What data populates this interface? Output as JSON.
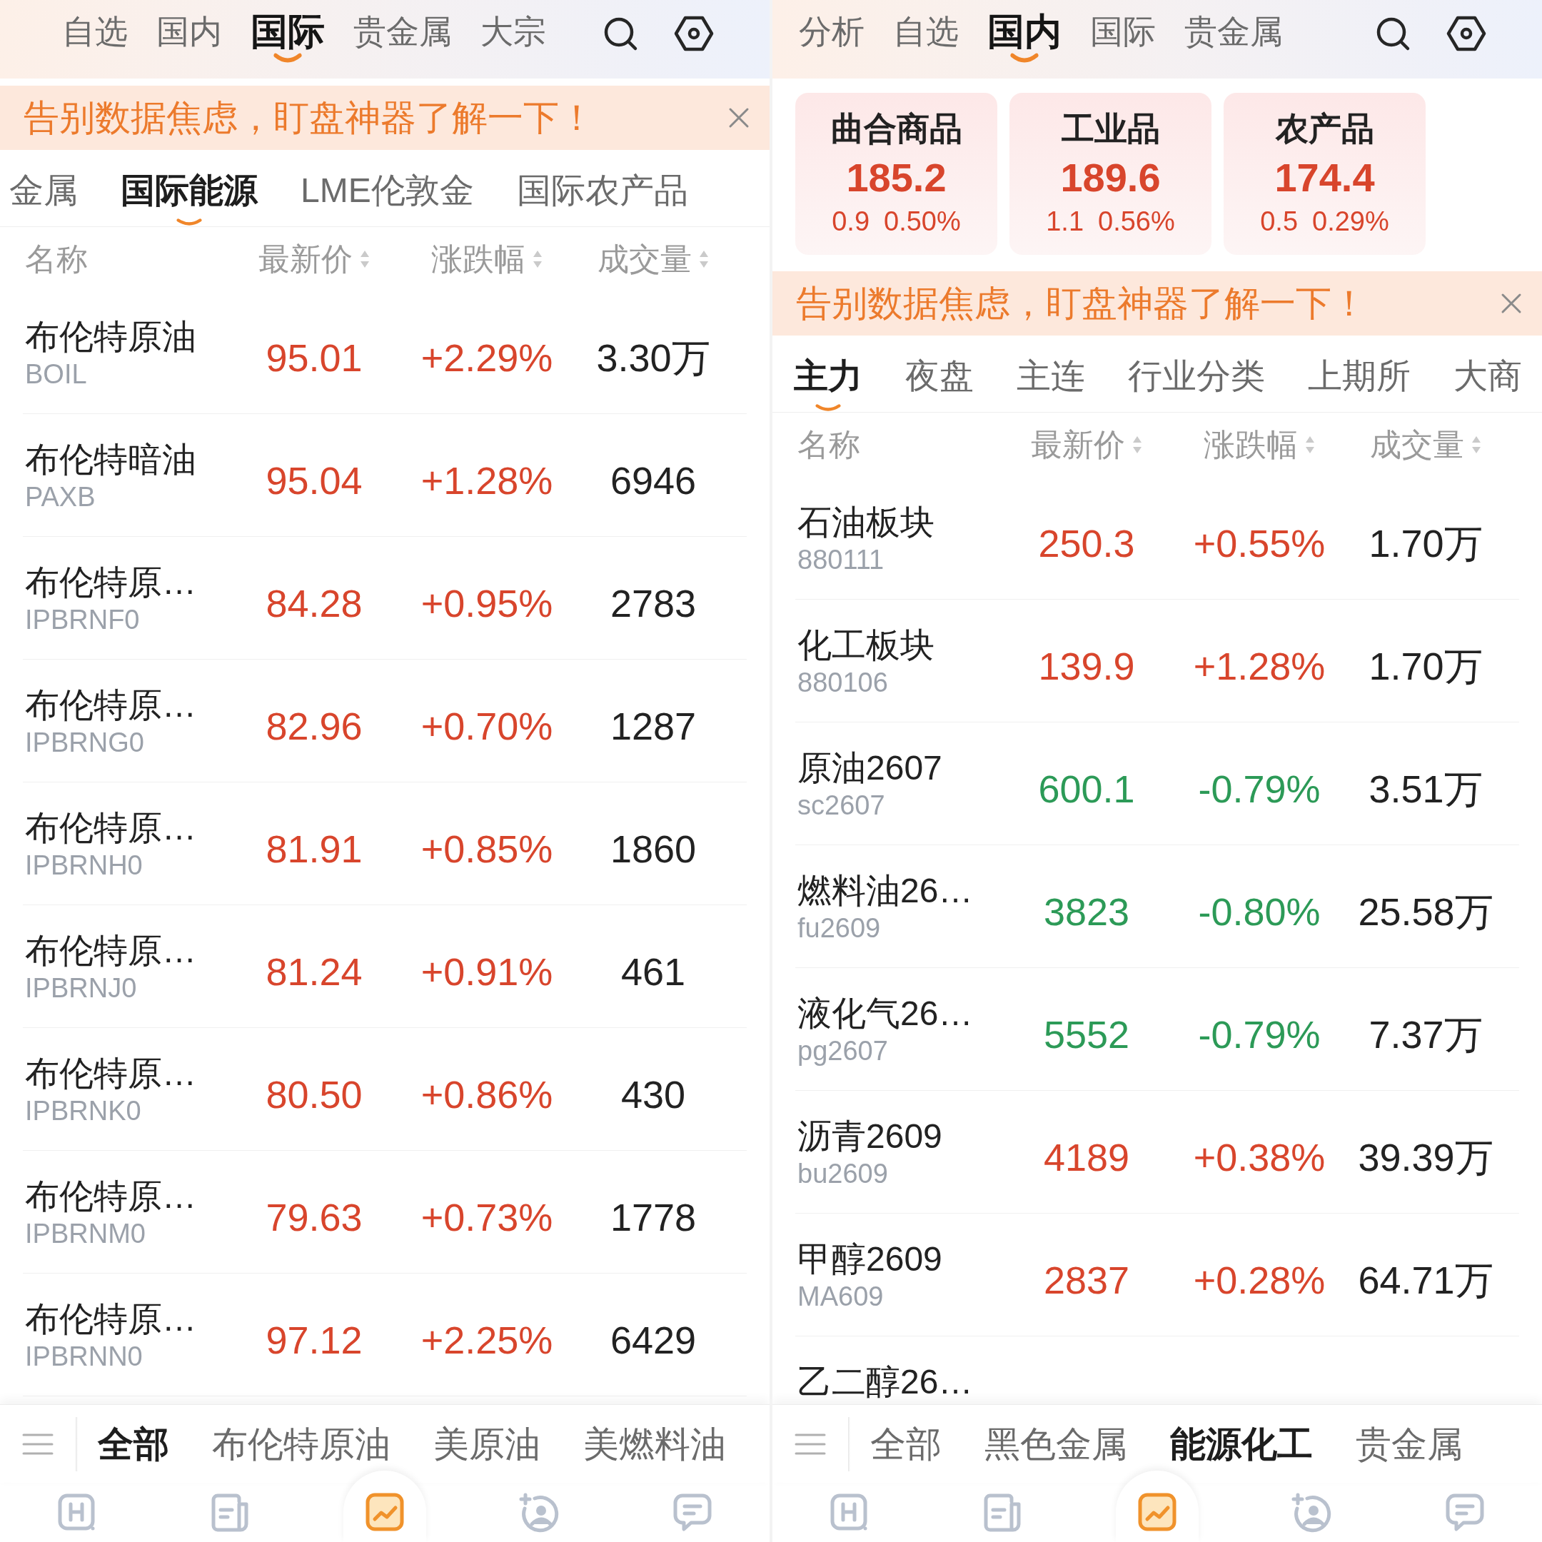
{
  "screens": [
    {
      "top_tabs": [
        {
          "label": "自选",
          "selected": false
        },
        {
          "label": "国内",
          "selected": false
        },
        {
          "label": "国际",
          "selected": true
        },
        {
          "label": "贵金属",
          "selected": false
        },
        {
          "label": "大宗",
          "selected": false
        }
      ],
      "banner": {
        "text": "告别数据焦虑，盯盘神器了解一下！"
      },
      "sub_tabs": [
        {
          "label": "金属",
          "selected": false
        },
        {
          "label": "国际能源",
          "selected": true
        },
        {
          "label": "LME伦敦金",
          "selected": false
        },
        {
          "label": "国际农产品",
          "selected": false
        }
      ],
      "table": {
        "columns": [
          {
            "label": "名称",
            "sortable": false
          },
          {
            "label": "最新价",
            "sortable": true
          },
          {
            "label": "涨跌幅",
            "sortable": true
          },
          {
            "label": "成交量",
            "sortable": true
          }
        ],
        "rows": [
          {
            "name": "布伦特原油",
            "code": "BOIL",
            "price": "95.01",
            "change": "+2.29%",
            "volume": "3.30万",
            "color": "#d8452c"
          },
          {
            "name": "布伦特暗油",
            "code": "PAXB",
            "price": "95.04",
            "change": "+1.28%",
            "volume": "6946",
            "color": "#d8452c"
          },
          {
            "name": "布伦特原…",
            "code": "IPBRNF0",
            "price": "84.28",
            "change": "+0.95%",
            "volume": "2783",
            "color": "#d8452c"
          },
          {
            "name": "布伦特原…",
            "code": "IPBRNG0",
            "price": "82.96",
            "change": "+0.70%",
            "volume": "1287",
            "color": "#d8452c"
          },
          {
            "name": "布伦特原…",
            "code": "IPBRNH0",
            "price": "81.91",
            "change": "+0.85%",
            "volume": "1860",
            "color": "#d8452c"
          },
          {
            "name": "布伦特原…",
            "code": "IPBRNJ0",
            "price": "81.24",
            "change": "+0.91%",
            "volume": "461",
            "color": "#d8452c"
          },
          {
            "name": "布伦特原…",
            "code": "IPBRNK0",
            "price": "80.50",
            "change": "+0.86%",
            "volume": "430",
            "color": "#d8452c"
          },
          {
            "name": "布伦特原…",
            "code": "IPBRNM0",
            "price": "79.63",
            "change": "+0.73%",
            "volume": "1778",
            "color": "#d8452c"
          },
          {
            "name": "布伦特原…",
            "code": "IPBRNN0",
            "price": "97.12",
            "change": "+2.25%",
            "volume": "6429",
            "color": "#d8452c"
          }
        ]
      },
      "category_bar": [
        {
          "label": "全部",
          "selected": true
        },
        {
          "label": "布伦特原油",
          "selected": false
        },
        {
          "label": "美原油",
          "selected": false
        },
        {
          "label": "美燃料油",
          "selected": false
        }
      ],
      "bottom_nav": [
        {
          "selected": false
        },
        {
          "selected": false
        },
        {
          "selected": true
        },
        {
          "selected": false
        },
        {
          "selected": false
        }
      ]
    },
    {
      "top_tabs": [
        {
          "label": "分析",
          "selected": false
        },
        {
          "label": "自选",
          "selected": false
        },
        {
          "label": "国内",
          "selected": true
        },
        {
          "label": "国际",
          "selected": false
        },
        {
          "label": "贵金属",
          "selected": false
        }
      ],
      "index_cards": [
        {
          "name": "曲合商品",
          "value": "185.2",
          "change": "0.9",
          "change_percent": "0.50%",
          "color": "#d8452c"
        },
        {
          "name": "工业品",
          "value": "189.6",
          "change": "1.1",
          "change_percent": "0.56%",
          "color": "#d8452c"
        },
        {
          "name": "农产品",
          "value": "174.4",
          "change": "0.5",
          "change_percent": "0.29%",
          "color": "#d8452c"
        }
      ],
      "banner": {
        "text": "告别数据焦虑，盯盘神器了解一下！"
      },
      "sub_tabs": [
        {
          "label": "主力",
          "selected": true
        },
        {
          "label": "夜盘",
          "selected": false
        },
        {
          "label": "主连",
          "selected": false
        },
        {
          "label": "行业分类",
          "selected": false
        },
        {
          "label": "上期所",
          "selected": false
        },
        {
          "label": "大商",
          "selected": false
        }
      ],
      "table": {
        "columns": [
          {
            "label": "名称",
            "sortable": false
          },
          {
            "label": "最新价",
            "sortable": true
          },
          {
            "label": "涨跌幅",
            "sortable": true
          },
          {
            "label": "成交量",
            "sortable": true
          }
        ],
        "rows": [
          {
            "name": "石油板块",
            "code": "880111",
            "price": "250.3",
            "change": "+0.55%",
            "volume": "1.70万",
            "color": "#d8452c"
          },
          {
            "name": "化工板块",
            "code": "880106",
            "price": "139.9",
            "change": "+1.28%",
            "volume": "1.70万",
            "color": "#d8452c"
          },
          {
            "name": "原油2607",
            "code": "sc2607",
            "price": "600.1",
            "change": "-0.79%",
            "volume": "3.51万",
            "color": "#2c9a57"
          },
          {
            "name": "燃料油26…",
            "code": "fu2609",
            "price": "3823",
            "change": "-0.80%",
            "volume": "25.58万",
            "color": "#2c9a57"
          },
          {
            "name": "液化气26…",
            "code": "pg2607",
            "price": "5552",
            "change": "-0.79%",
            "volume": "7.37万",
            "color": "#2c9a57"
          },
          {
            "name": "沥青2609",
            "code": "bu2609",
            "price": "4189",
            "change": "+0.38%",
            "volume": "39.39万",
            "color": "#d8452c"
          },
          {
            "name": "甲醇2609",
            "code": "MA609",
            "price": "2837",
            "change": "+0.28%",
            "volume": "64.71万",
            "color": "#d8452c"
          },
          {
            "name": "乙二醇26…"
          }
        ]
      },
      "category_bar": [
        {
          "label": "全部",
          "selected": false
        },
        {
          "label": "黑色金属",
          "selected": false
        },
        {
          "label": "能源化工",
          "selected": true
        },
        {
          "label": "贵金属",
          "selected": false
        }
      ],
      "bottom_nav": [
        {
          "selected": false
        },
        {
          "selected": false
        },
        {
          "selected": true
        },
        {
          "selected": false
        },
        {
          "selected": false
        }
      ]
    }
  ]
}
